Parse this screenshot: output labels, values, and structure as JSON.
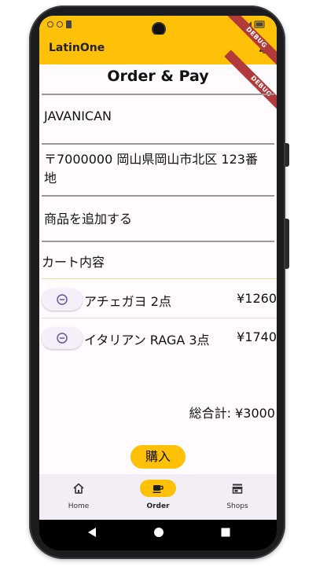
{
  "status_bar": {
    "time": "1",
    "right_icons": "wifi-signal-battery"
  },
  "app": {
    "title": "LatinOne",
    "debug_banner": "DEBUG"
  },
  "page": {
    "title": "Order & Pay"
  },
  "shop_name": "JAVANICAN",
  "address": {
    "line1": "〒7000000 岡山県岡山市北区 123番",
    "line2": "地"
  },
  "add_item_label": "商品を追加する",
  "cart": {
    "title": "カート内容",
    "items": [
      {
        "name": "アチェガヨ 2点",
        "price": "¥1260"
      },
      {
        "name": "イタリアン RAGA 3点",
        "price": "¥1740"
      }
    ],
    "total": "総合計: ¥3000"
  },
  "buy_button": "購入",
  "bottom_nav": [
    {
      "label": "Home",
      "icon": "home-icon",
      "active": false
    },
    {
      "label": "Order",
      "icon": "coffee-icon",
      "active": true
    },
    {
      "label": "Shops",
      "icon": "store-icon",
      "active": false
    }
  ],
  "colors": {
    "accent": "#ffc107",
    "nav_bg": "#f3edf6",
    "screen_bg": "#fffbfe"
  }
}
